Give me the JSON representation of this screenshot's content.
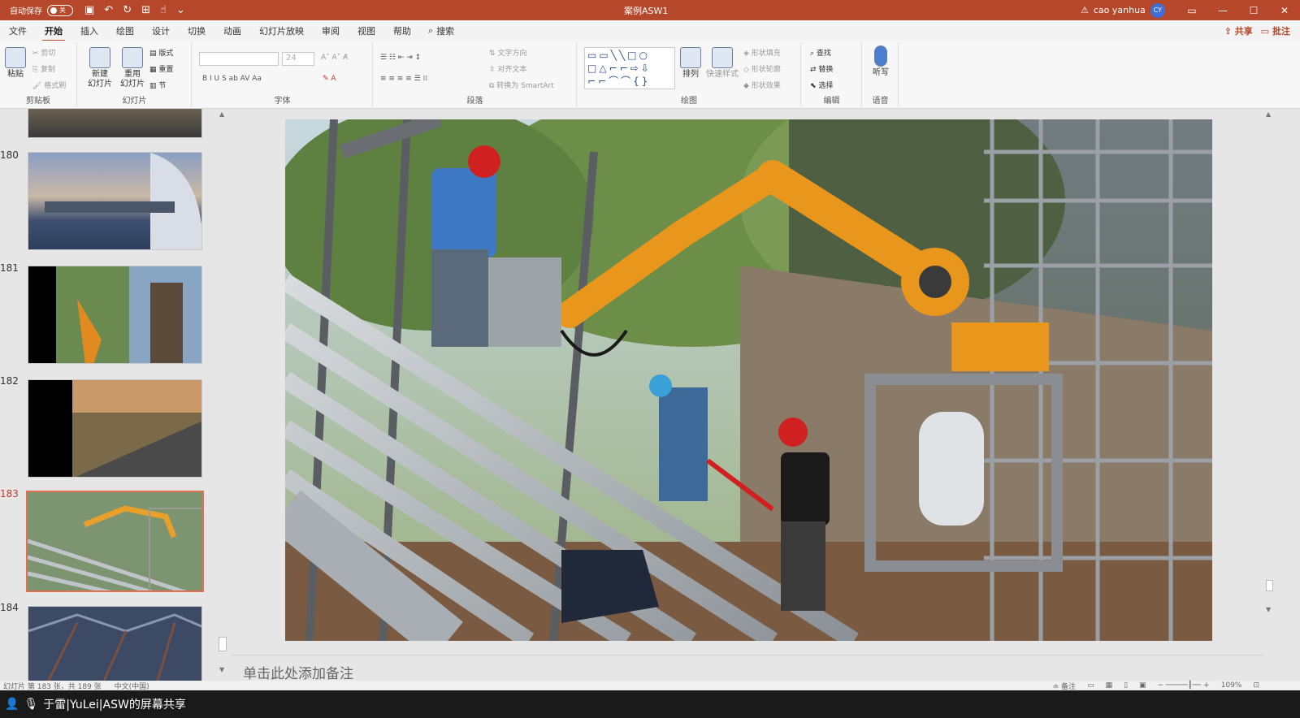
{
  "titlebar": {
    "autosave_label": "自动保存",
    "autosave_state": "关",
    "doc_title": "案例ASW1",
    "user_name": "cao yanhua",
    "user_initials": "CY"
  },
  "menu": {
    "tabs": [
      "文件",
      "开始",
      "插入",
      "绘图",
      "设计",
      "切换",
      "动画",
      "幻灯片放映",
      "审阅",
      "视图",
      "帮助"
    ],
    "active_tab": "开始",
    "search_label": "搜索",
    "share_label": "共享",
    "comments_label": "批注"
  },
  "ribbon": {
    "clipboard": {
      "label": "剪贴板",
      "paste": "粘贴",
      "cut": "剪切",
      "copy": "复制",
      "format_painter": "格式刷"
    },
    "slides": {
      "label": "幻灯片",
      "new_slide": "新建\n幻灯片",
      "reuse_slide": "重用\n幻灯片",
      "layout": "版式",
      "reset": "重置",
      "section": "节"
    },
    "font": {
      "label": "字体",
      "size": "24"
    },
    "paragraph": {
      "label": "段落",
      "text_direction": "文字方向",
      "align_text": "对齐文本",
      "smartart": "转换为 SmartArt"
    },
    "drawing": {
      "label": "绘图",
      "arrange": "排列",
      "quick_styles": "快速样式",
      "shape_fill": "形状填充",
      "shape_outline": "形状轮廓",
      "shape_effects": "形状效果"
    },
    "editing": {
      "label": "编辑",
      "find": "查找",
      "replace": "替换",
      "select": "选择"
    },
    "voice": {
      "label": "语音",
      "dictate": "听写"
    }
  },
  "slides": [
    {
      "num": "180"
    },
    {
      "num": "181"
    },
    {
      "num": "182"
    },
    {
      "num": "183",
      "selected": true
    },
    {
      "num": "184"
    }
  ],
  "notes_placeholder": "单击此处添加备注",
  "statusbar": {
    "slide_info": "幻灯片 第 183 张，共 189 张",
    "language": "中文(中国)",
    "notes_btn": "备注",
    "zoom": "109%"
  },
  "share_banner": "于雷|YuLei|ASW的屏幕共享"
}
